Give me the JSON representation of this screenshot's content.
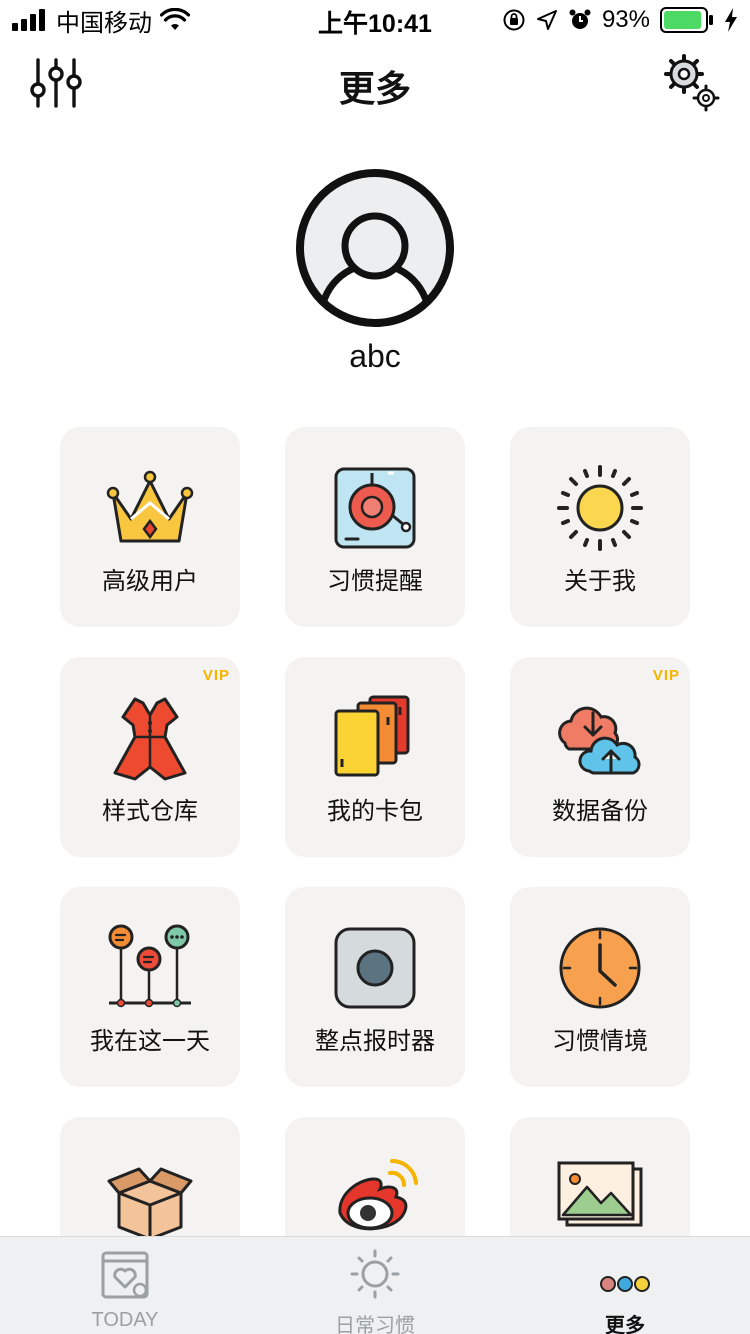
{
  "status_bar": {
    "carrier": "中国移动",
    "time": "上午10:41",
    "battery_percent": "93%",
    "battery_level": 0.93,
    "icons": [
      "signal-bars-icon",
      "wifi-icon",
      "orientation-lock-icon",
      "location-arrow-icon",
      "alarm-clock-icon",
      "battery-icon",
      "charging-bolt-icon"
    ]
  },
  "header": {
    "title": "更多",
    "left_icon": "sliders-icon",
    "right_icon": "gears-icon"
  },
  "profile": {
    "username": "abc",
    "avatar_icon": "user-avatar-icon"
  },
  "grid": {
    "items": [
      {
        "label": "高级用户",
        "icon": "crown-icon",
        "vip": ""
      },
      {
        "label": "习惯提醒",
        "icon": "alarm-bell-icon",
        "vip": ""
      },
      {
        "label": "关于我",
        "icon": "sun-icon",
        "vip": ""
      },
      {
        "label": "样式仓库",
        "icon": "dress-icon",
        "vip": "VIP"
      },
      {
        "label": "我的卡包",
        "icon": "cards-icon",
        "vip": ""
      },
      {
        "label": "数据备份",
        "icon": "cloud-sync-icon",
        "vip": "VIP"
      },
      {
        "label": "我在这一天",
        "icon": "timeline-pins-icon",
        "vip": ""
      },
      {
        "label": "整点报时器",
        "icon": "round-button-icon",
        "vip": ""
      },
      {
        "label": "习惯情境",
        "icon": "clock-icon",
        "vip": ""
      },
      {
        "label": "",
        "icon": "box-icon",
        "vip": ""
      },
      {
        "label": "",
        "icon": "weibo-icon",
        "vip": ""
      },
      {
        "label": "",
        "icon": "landscape-photo-icon",
        "vip": ""
      }
    ]
  },
  "tab_bar": {
    "tabs": [
      {
        "label": "TODAY",
        "icon": "calendar-heart-icon",
        "active": false
      },
      {
        "label": "日常习惯",
        "icon": "sun-outline-icon",
        "active": false
      },
      {
        "label": "更多",
        "icon": "three-dots-icon",
        "active": true
      }
    ]
  },
  "colors": {
    "card_bg": "#f4f3f1",
    "vip_badge": "#f5b400",
    "tab_bar_bg": "#eef0f1",
    "battery_green": "#4cd964",
    "tab_inactive": "#9aa0a3"
  }
}
